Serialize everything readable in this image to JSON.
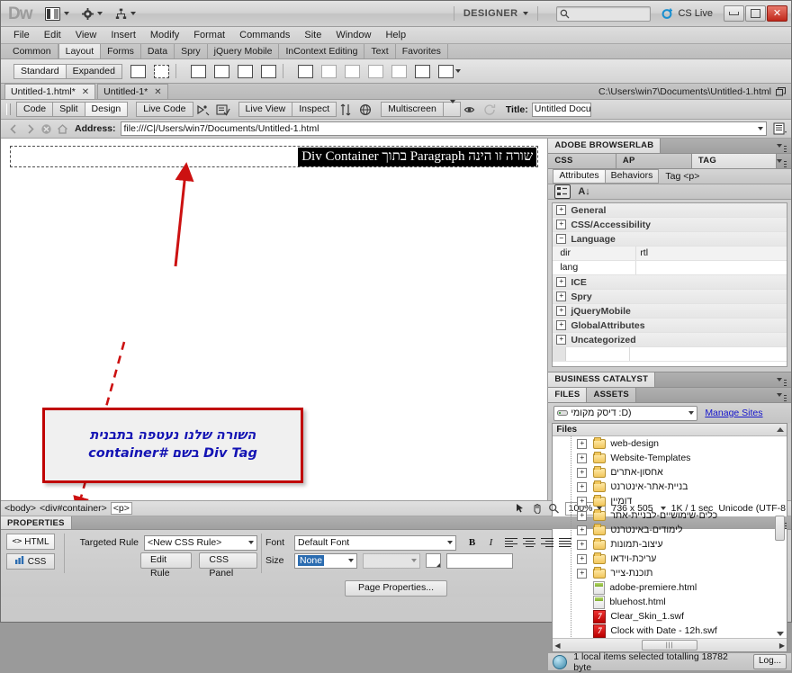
{
  "titlebar": {
    "app_abbrev": "Dw",
    "workspace": "DESIGNER",
    "search_placeholder": "",
    "cs_live": "CS Live",
    "buttons": {
      "minimize": "minimize",
      "restore": "restore",
      "close": "✕"
    }
  },
  "menubar": [
    "File",
    "Edit",
    "View",
    "Insert",
    "Modify",
    "Format",
    "Commands",
    "Site",
    "Window",
    "Help"
  ],
  "insert_panel": {
    "tabs": [
      "Common",
      "Layout",
      "Forms",
      "Data",
      "Spry",
      "jQuery Mobile",
      "InContext Editing",
      "Text",
      "Favorites"
    ],
    "active_tab": "Layout",
    "mode_buttons": [
      "Standard",
      "Expanded"
    ],
    "active_mode": "Standard"
  },
  "doc_tabs": {
    "tabs": [
      {
        "label": "Untitled-1.html*",
        "active": true
      },
      {
        "label": "Untitled-1*",
        "active": false
      }
    ],
    "path": "C:\\Users\\win7\\Documents\\Untitled-1.html"
  },
  "doc_toolbar": {
    "view_buttons": [
      "Code",
      "Split",
      "Design"
    ],
    "active_view": "Design",
    "live_code": "Live Code",
    "live_view": "Live View",
    "inspect": "Inspect",
    "multiscreen": "Multiscreen",
    "title_label": "Title:",
    "title_value": "Untitled Docu"
  },
  "address_bar": {
    "label": "Address:",
    "value": "file:///C|/Users/win7/Documents/Untitled-1.html"
  },
  "canvas": {
    "paragraph_text": "שורה זו הינה Paragraph בתוך Div Container",
    "callout_line1": "השורה שלנו נעטפה בתבנית",
    "callout_line2": "Div Tag בשם #container",
    "callout_border_color": "#c00000",
    "callout_text_color": "#1414b4",
    "arrow_color": "#cc1111"
  },
  "right_panel": {
    "browserlab_title": "ADOBE BROWSERLAB",
    "panel_tabs": [
      "CSS STYLES",
      "AP ELEMENTS",
      "TAG INSPECTOR"
    ],
    "active_panel_tab": "TAG INSPECTOR",
    "sub_tabs": [
      "Attributes",
      "Behaviors"
    ],
    "active_sub_tab": "Attributes",
    "tag_label": "Tag <p>",
    "attribute_categories": [
      {
        "name": "General",
        "expanded": false
      },
      {
        "name": "CSS/Accessibility",
        "expanded": false
      },
      {
        "name": "Language",
        "expanded": true
      },
      {
        "name": "ICE",
        "expanded": false
      },
      {
        "name": "Spry",
        "expanded": false
      },
      {
        "name": "jQueryMobile",
        "expanded": false
      },
      {
        "name": "GlobalAttributes",
        "expanded": false
      },
      {
        "name": "Uncategorized",
        "expanded": false
      }
    ],
    "language_attrs": [
      {
        "key": "dir",
        "value": "rtl"
      },
      {
        "key": "lang",
        "value": ""
      }
    ],
    "business_catalyst": "BUSINESS CATALYST",
    "files_tabs": [
      "FILES",
      "ASSETS"
    ],
    "active_files_tab": "FILES",
    "drive_label": "(D: דיסק מקומי",
    "manage_sites": "Manage Sites",
    "files_header": "Files",
    "file_tree": [
      {
        "name": "web-design",
        "type": "folder",
        "expandable": true
      },
      {
        "name": "Website-Templates",
        "type": "folder",
        "expandable": true
      },
      {
        "name": "אחסון-אתרים",
        "type": "folder",
        "expandable": true,
        "rtl": true
      },
      {
        "name": "בניית-אתר-אינטרנט",
        "type": "folder",
        "expandable": true,
        "rtl": true
      },
      {
        "name": "דומיין",
        "type": "folder",
        "expandable": true,
        "rtl": true
      },
      {
        "name": "כלים-שימושיים-לבניית-אתר",
        "type": "folder",
        "expandable": true,
        "rtl": true
      },
      {
        "name": "לימודים-באינטרנט",
        "type": "folder",
        "expandable": true,
        "rtl": true
      },
      {
        "name": "עיצוב-תמונות",
        "type": "folder",
        "expandable": true,
        "rtl": true
      },
      {
        "name": "עריכת-וידאו",
        "type": "folder",
        "expandable": true,
        "rtl": true
      },
      {
        "name": "תוכנת-צייר",
        "type": "folder",
        "expandable": true,
        "rtl": true
      },
      {
        "name": "adobe-premiere.html",
        "type": "html",
        "expandable": false
      },
      {
        "name": "bluehost.html",
        "type": "html",
        "expandable": false
      },
      {
        "name": "Clear_Skin_1.swf",
        "type": "swf",
        "expandable": false
      },
      {
        "name": "Clock with Date - 12h.swf",
        "type": "swf",
        "expandable": false
      }
    ],
    "status_text": "1 local items selected totalling 18782 byte",
    "log_button": "Log..."
  },
  "status_bar": {
    "tag_path": [
      "<body>",
      "<div#container>",
      "<p>"
    ],
    "selected_tag": "<p>",
    "zoom": "100%",
    "window_size": "736 x 505",
    "download": "1K / 1 sec",
    "encoding": "Unicode (UTF-8"
  },
  "properties": {
    "header": "PROPERTIES",
    "html_button": "HTML",
    "css_button": "CSS",
    "targeted_rule_label": "Targeted Rule",
    "targeted_rule_value": "<New CSS Rule>",
    "edit_rule": "Edit Rule",
    "css_panel": "CSS Panel",
    "font_label": "Font",
    "font_value": "Default Font",
    "size_label": "Size",
    "size_value": "None",
    "bold": "B",
    "italic": "I",
    "page_properties": "Page Properties..."
  }
}
